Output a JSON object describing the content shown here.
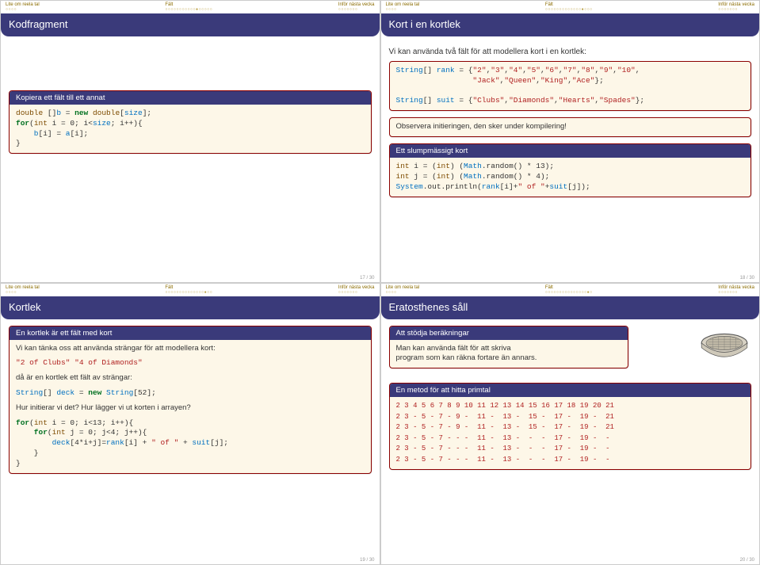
{
  "nav": {
    "sections": [
      {
        "label": "Lite om reela tal",
        "dots": "○○○○"
      },
      {
        "label": "Fält",
        "dots": "○○○○○○○○○○○●○○○○○"
      },
      {
        "label": "Inför nästa vecka",
        "dots": "○○○○○○○"
      }
    ],
    "alt_sections_row2": [
      {
        "label": "Lite om reela tal",
        "dots": "○○○○"
      },
      {
        "label": "Fält",
        "dots": "○○○○○○○○○○○○○●○○○"
      },
      {
        "label": "Inför nästa vecka",
        "dots": "○○○○○○○"
      }
    ],
    "alt_sections_row3": [
      {
        "label": "Lite om reela tal",
        "dots": "○○○○"
      },
      {
        "label": "Fält",
        "dots": "○○○○○○○○○○○○○○●○○"
      },
      {
        "label": "Inför nästa vecka",
        "dots": "○○○○○○○"
      }
    ],
    "alt_sections_row4": [
      {
        "label": "Lite om reela tal",
        "dots": "○○○○"
      },
      {
        "label": "Fält",
        "dots": "○○○○○○○○○○○○○○○●○"
      },
      {
        "label": "Inför nästa vecka",
        "dots": "○○○○○○○"
      }
    ]
  },
  "s17": {
    "title": "Kodfragment",
    "box_hdr": "Kopiera ett fält till ett annat",
    "code": {
      "l1_a": "double",
      "l1_b": " []",
      "l1_c": "b",
      "l1_d": " = ",
      "l1_e": "new",
      "l1_f": " double",
      "l1_g": "[",
      "l1_h": "size",
      "l1_i": "];",
      "l2_a": "for",
      "l2_b": "(",
      "l2_c": "int",
      "l2_d": " i = 0; i<",
      "l2_e": "size",
      "l2_f": "; i++){",
      "l3_a": "    b",
      "l3_b": "[i] = ",
      "l3_c": "a",
      "l3_d": "[i];",
      "l4": "}"
    },
    "page": "17 / 30"
  },
  "s18": {
    "title": "Kort i en kortlek",
    "intro": "Vi kan använda två fält för att modellera kort i en kortlek:",
    "code1": {
      "l1_a": "String",
      "l1_b": "[] ",
      "l1_c": "rank",
      "l1_d": " = {",
      "l1_e": "\"2\"",
      "l1_f": ",",
      "l1_g": "\"3\"",
      "l1_h": ",",
      "l1_i": "\"4\"",
      "l1_j": ",",
      "l1_k": "\"5\"",
      "l1_l": ",",
      "l1_m": "\"6\"",
      "l1_n": ",",
      "l1_o": "\"7\"",
      "l1_p": ",",
      "l1_q": "\"8\"",
      "l1_r": ",",
      "l1_s": "\"9\"",
      "l1_t": ",",
      "l1_u": "\"10\"",
      "l1_v": ",",
      "l2_pad": "                 ",
      "l2_a": "\"Jack\"",
      "l2_b": ",",
      "l2_c": "\"Queen\"",
      "l2_d": ",",
      "l2_e": "\"King\"",
      "l2_f": ",",
      "l2_g": "\"Ace\"",
      "l2_h": "};",
      "blank": "",
      "l3_a": "String",
      "l3_b": "[] ",
      "l3_c": "suit",
      "l3_d": " = {",
      "l3_e": "\"Clubs\"",
      "l3_f": ",",
      "l3_g": "\"Diamonds\"",
      "l3_h": ",",
      "l3_i": "\"Hearts\"",
      "l3_j": ",",
      "l3_k": "\"Spades\"",
      "l3_l": "};"
    },
    "note": "Observera initieringen, den sker under kompilering!",
    "box2_hdr": "Ett slumpmässigt kort",
    "code2": {
      "l1_a": "int",
      "l1_b": " i = (",
      "l1_c": "int",
      "l1_d": ") (",
      "l1_e": "Math",
      "l1_f": ".random() * 13);",
      "l2_a": "int",
      "l2_b": " j = (",
      "l2_c": "int",
      "l2_d": ") (",
      "l2_e": "Math",
      "l2_f": ".random() * 4);",
      "l3_a": "System",
      "l3_b": ".out.println(",
      "l3_c": "rank",
      "l3_d": "[i]+",
      "l3_e": "\" of \"",
      "l3_f": "+",
      "l3_g": "suit",
      "l3_h": "[j]);"
    },
    "page": "18 / 30"
  },
  "s19": {
    "title": "Kortlek",
    "box_hdr": "En kortlek är ett fält med kort",
    "line1": "Vi kan tänka oss att använda strängar för att modellera kort:",
    "ex1_a": "\"2 of Clubs\"",
    "ex1_sp": " ",
    "ex1_b": "\"4 of Diamonds\"",
    "line2": "då är en kortlek ett fält av strängar:",
    "code1": {
      "a": "String",
      "b": "[] ",
      "c": "deck",
      "d": " = ",
      "e": "new",
      "f": " String",
      "g": "[52];"
    },
    "q": "Hur initierar vi det? Hur lägger vi ut korten i arrayen?",
    "code2": {
      "l1_a": "for",
      "l1_b": "(",
      "l1_c": "int",
      "l1_d": " i = 0; i<13; i++){",
      "l2_a": "    for",
      "l2_b": "(",
      "l2_c": "int",
      "l2_d": " j = 0; j<4; j++){",
      "l3_a": "        deck",
      "l3_b": "[4*i+j]=",
      "l3_c": "rank",
      "l3_d": "[i] + ",
      "l3_e": "\" of \"",
      "l3_f": " + ",
      "l3_g": "suit",
      "l3_h": "[j];",
      "l4": "    }",
      "l5": "}"
    },
    "page": "19 / 30"
  },
  "s20": {
    "title": "Eratosthenes såll",
    "box1_hdr": "Att stödja beräkningar",
    "box1_txt": "Man kan använda fält för att skriva\nprogram som kan räkna fortare än annars.",
    "box2_hdr": "En metod för att hitta primtal",
    "rows": [
      "2 3 4 5 6 7 8 9 10 11 12 13 14 15 16 17 18 19 20 21",
      "2 3 - 5 - 7 - 9 -  11 -  13 -  15 -  17 -  19 -  21",
      "2 3 - 5 - 7 - 9 -  11 -  13 -  15 -  17 -  19 -  21",
      "2 3 - 5 - 7 - - -  11 -  13 -  -  -  17 -  19 -  -",
      "2 3 - 5 - 7 - - -  11 -  13 -  -  -  17 -  19 -  -",
      "2 3 - 5 - 7 - - -  11 -  13 -  -  -  17 -  19 -  -"
    ],
    "page": "20 / 30"
  }
}
